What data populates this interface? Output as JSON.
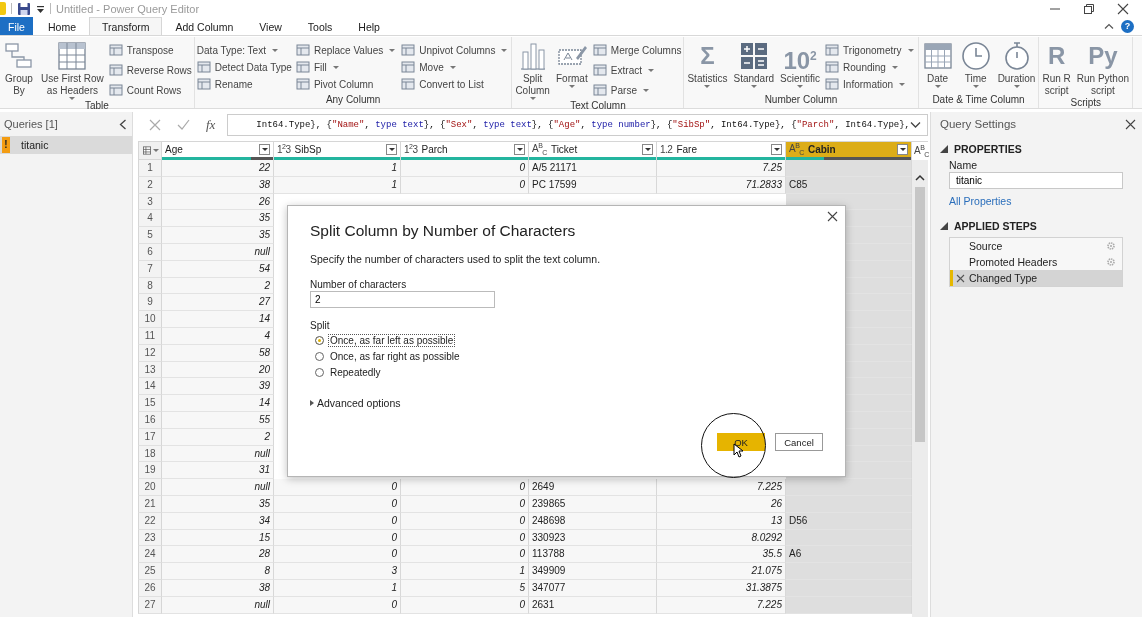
{
  "window": {
    "title": "Untitled - Power Query Editor"
  },
  "tabs": [
    {
      "label": "File",
      "kind": "file",
      "selected": false
    },
    {
      "label": "Home",
      "kind": "tab",
      "selected": false
    },
    {
      "label": "Transform",
      "kind": "tab",
      "selected": true
    },
    {
      "label": "Add Column",
      "kind": "tab",
      "selected": false
    },
    {
      "label": "View",
      "kind": "tab",
      "selected": false
    },
    {
      "label": "Tools",
      "kind": "tab",
      "selected": false
    },
    {
      "label": "Help",
      "kind": "tab",
      "selected": false
    }
  ],
  "help": {
    "label": "?"
  },
  "ribbon": {
    "groups": [
      {
        "label": "Table",
        "items": [
          {
            "kind": "flow",
            "label": "Group\nBy",
            "dropdown": false
          },
          {
            "kind": "grid",
            "label": "Use First Row\nas Headers",
            "dropdown": true
          },
          {
            "kind": "stack",
            "entries": [
              {
                "label": "Transpose",
                "icon": true,
                "dropdown": false
              },
              {
                "label": "Reverse Rows",
                "icon": true,
                "dropdown": false
              },
              {
                "label": "Count Rows",
                "icon": true,
                "dropdown": false
              }
            ]
          }
        ]
      },
      {
        "label": "Any Column",
        "items": [
          {
            "kind": "stack",
            "entries": [
              {
                "label": "Data Type: Text",
                "icon": false,
                "dropdown": true
              },
              {
                "label": "Detect Data Type",
                "icon": true,
                "dropdown": false
              },
              {
                "label": "Rename",
                "icon": true,
                "dropdown": false
              }
            ]
          },
          {
            "kind": "stack",
            "entries": [
              {
                "label": "Replace Values",
                "icon": true,
                "dropdown": true
              },
              {
                "label": "Fill",
                "icon": true,
                "dropdown": true
              },
              {
                "label": "Pivot Column",
                "icon": true,
                "dropdown": false
              }
            ]
          },
          {
            "kind": "stack",
            "entries": [
              {
                "label": "Unpivot Columns",
                "icon": true,
                "dropdown": true
              },
              {
                "label": "Move",
                "icon": true,
                "dropdown": true
              },
              {
                "label": "Convert to List",
                "icon": true,
                "dropdown": false
              }
            ]
          }
        ]
      },
      {
        "label": "Text Column",
        "items": [
          {
            "kind": "bars",
            "label": "Split\nColumn",
            "dropdown": true
          },
          {
            "kind": "textbox",
            "label": "Format",
            "dropdown": true
          },
          {
            "kind": "stack",
            "entries": [
              {
                "label": "Merge Columns",
                "icon": true,
                "dropdown": false
              },
              {
                "label": "Extract",
                "icon": true,
                "dropdown": true
              },
              {
                "label": "Parse",
                "icon": true,
                "dropdown": true
              }
            ]
          }
        ]
      },
      {
        "label": "Number Column",
        "items": [
          {
            "kind": "glyph",
            "glyph": "Σ",
            "label": "Statistics",
            "dropdown": true
          },
          {
            "kind": "calculator",
            "label": "Standard",
            "dropdown": true
          },
          {
            "kind": "glyph",
            "glyph": "10$^{2}$",
            "label": "Scientific",
            "dropdown": true
          },
          {
            "kind": "stack",
            "entries": [
              {
                "label": "Trigonometry",
                "icon": true,
                "dropdown": true
              },
              {
                "label": "Rounding",
                "icon": true,
                "dropdown": true
              },
              {
                "label": "Information",
                "icon": true,
                "dropdown": true
              }
            ]
          }
        ]
      },
      {
        "label": "Date & Time Column",
        "items": [
          {
            "kind": "calendar",
            "label": "Date",
            "dropdown": true
          },
          {
            "kind": "clock",
            "label": "Time",
            "dropdown": true
          },
          {
            "kind": "stopwatch",
            "label": "Duration",
            "dropdown": true
          }
        ]
      },
      {
        "label": "Scripts",
        "items": [
          {
            "kind": "glyph",
            "glyph": "R",
            "label": "Run R\nscript",
            "dropdown": false
          },
          {
            "kind": "glyph",
            "glyph": "Py",
            "label": "Run Python\nscript",
            "dropdown": false
          }
        ]
      }
    ]
  },
  "queries": {
    "title": "Queries [1]",
    "items": [
      {
        "name": "titanic",
        "badge": "!",
        "selected": true
      }
    ]
  },
  "formula": {
    "fx": "fx",
    "segments": [
      {
        "kind": "plain",
        "text": "Int64.Type}, {"
      },
      {
        "kind": "string",
        "text": "\"Name\""
      },
      {
        "kind": "plain",
        "text": ", "
      },
      {
        "kind": "keyword",
        "text": "type text"
      },
      {
        "kind": "plain",
        "text": "}, {"
      },
      {
        "kind": "string",
        "text": "\"Sex\""
      },
      {
        "kind": "plain",
        "text": ", "
      },
      {
        "kind": "keyword",
        "text": "type text"
      },
      {
        "kind": "plain",
        "text": "}, {"
      },
      {
        "kind": "string",
        "text": "\"Age\""
      },
      {
        "kind": "plain",
        "text": ", "
      },
      {
        "kind": "keyword",
        "text": "type number"
      },
      {
        "kind": "plain",
        "text": "}, {"
      },
      {
        "kind": "string",
        "text": "\"SibSp\""
      },
      {
        "kind": "plain",
        "text": ", Int64.Type}, {"
      },
      {
        "kind": "string",
        "text": "\"Parch\""
      },
      {
        "kind": "plain",
        "text": ", Int64.Type},"
      }
    ]
  },
  "table": {
    "columns": [
      {
        "name": "Age",
        "kind": "number",
        "level": 0.8,
        "selected": false
      },
      {
        "name": "SibSp",
        "type_label": "1$^{2}$3",
        "kind": "number",
        "level": 1,
        "selected": false
      },
      {
        "name": "Parch",
        "type_label": "1$^{2}$3",
        "kind": "number",
        "level": 1,
        "selected": false
      },
      {
        "name": "Ticket",
        "type_label": "A$^{B}$$_{C}$",
        "kind": "text",
        "level": 1,
        "selected": false
      },
      {
        "name": "Fare",
        "type_label": "1.2",
        "kind": "number",
        "level": 1,
        "selected": false
      },
      {
        "name": "Cabin",
        "type_label": "A$^{B}$$_{C}$",
        "kind": "text",
        "level": 0.3,
        "selected": true
      }
    ],
    "next_column": {
      "type_label": "A$^{B}$$_{C}$"
    },
    "rows": [
      {
        "number": "1",
        "cells": [
          "22",
          "1",
          "0",
          "A/5 21171",
          "7.25",
          null
        ]
      },
      {
        "number": "2",
        "cells": [
          "38",
          "1",
          "0",
          "PC 17599",
          "71.2833",
          "C85"
        ]
      },
      {
        "number": "3",
        "cells": [
          "26",
          null,
          null,
          null,
          null,
          null
        ]
      },
      {
        "number": "4",
        "cells": [
          "35",
          null,
          null,
          null,
          null,
          null
        ]
      },
      {
        "number": "5",
        "cells": [
          "35",
          null,
          null,
          null,
          null,
          null
        ]
      },
      {
        "number": "6",
        "cells": [
          "null",
          null,
          null,
          null,
          null,
          null
        ]
      },
      {
        "number": "7",
        "cells": [
          "54",
          null,
          null,
          null,
          null,
          null
        ]
      },
      {
        "number": "8",
        "cells": [
          "2",
          null,
          null,
          null,
          null,
          null
        ]
      },
      {
        "number": "9",
        "cells": [
          "27",
          null,
          null,
          null,
          null,
          null
        ]
      },
      {
        "number": "10",
        "cells": [
          "14",
          null,
          null,
          null,
          null,
          null
        ]
      },
      {
        "number": "11",
        "cells": [
          "4",
          null,
          null,
          null,
          null,
          null
        ]
      },
      {
        "number": "12",
        "cells": [
          "58",
          null,
          null,
          null,
          null,
          null
        ]
      },
      {
        "number": "13",
        "cells": [
          "20",
          null,
          null,
          null,
          null,
          null
        ]
      },
      {
        "number": "14",
        "cells": [
          "39",
          null,
          null,
          null,
          null,
          null
        ]
      },
      {
        "number": "15",
        "cells": [
          "14",
          null,
          null,
          null,
          null,
          null
        ]
      },
      {
        "number": "16",
        "cells": [
          "55",
          null,
          null,
          null,
          null,
          null
        ]
      },
      {
        "number": "17",
        "cells": [
          "2",
          null,
          null,
          null,
          null,
          null
        ]
      },
      {
        "number": "18",
        "cells": [
          "null",
          null,
          null,
          null,
          null,
          null
        ]
      },
      {
        "number": "19",
        "cells": [
          "31",
          null,
          null,
          null,
          null,
          null
        ]
      },
      {
        "number": "20",
        "cells": [
          "null",
          "0",
          "0",
          "2649",
          "7.225",
          null
        ]
      },
      {
        "number": "21",
        "cells": [
          "35",
          "0",
          "0",
          "239865",
          "26",
          null
        ]
      },
      {
        "number": "22",
        "cells": [
          "34",
          "0",
          "0",
          "248698",
          "13",
          "D56"
        ]
      },
      {
        "number": "23",
        "cells": [
          "15",
          "0",
          "0",
          "330923",
          "8.0292",
          null
        ]
      },
      {
        "number": "24",
        "cells": [
          "28",
          "0",
          "0",
          "113788",
          "35.5",
          "A6"
        ]
      },
      {
        "number": "25",
        "cells": [
          "8",
          "3",
          "1",
          "349909",
          "21.075",
          null
        ]
      },
      {
        "number": "26",
        "cells": [
          "38",
          "1",
          "5",
          "347077",
          "31.3875",
          null
        ]
      },
      {
        "number": "27",
        "cells": [
          "null",
          "0",
          "0",
          "2631",
          "7.225",
          null
        ]
      }
    ]
  },
  "settings": {
    "title": "Query Settings",
    "properties": {
      "heading": "PROPERTIES",
      "expanded": true,
      "name_label": "Name",
      "name_value": "titanic",
      "link": "All Properties"
    },
    "steps_section": {
      "heading": "APPLIED STEPS",
      "expanded": true
    },
    "steps": [
      {
        "label": "Source",
        "has_settings": true,
        "selected": false
      },
      {
        "label": "Promoted Headers",
        "has_settings": true,
        "selected": false
      },
      {
        "label": "Changed Type",
        "has_settings": false,
        "selected": true
      }
    ]
  },
  "dialog": {
    "title": "Split Column by Number of Characters",
    "description": "Specify the number of characters used to split the text column.",
    "field_label": "Number of characters",
    "field_value": "2",
    "split_label": "Split",
    "options": [
      {
        "label": "Once, as far left as possible",
        "selected": true
      },
      {
        "label": "Once, as far right as possible",
        "selected": false
      },
      {
        "label": "Repeatedly",
        "selected": false
      }
    ],
    "advanced": {
      "label": "Advanced options",
      "expanded": false
    },
    "buttons": [
      {
        "label": "OK",
        "kind": "primary"
      },
      {
        "label": "Cancel",
        "kind": "secondary"
      }
    ]
  }
}
